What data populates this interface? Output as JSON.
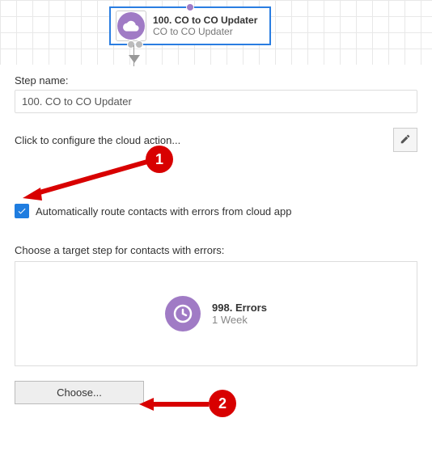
{
  "canvas": {
    "step_title": "100. CO to CO Updater",
    "step_subtitle": "CO to CO Updater",
    "icon": "cloud-icon"
  },
  "form": {
    "step_name_label": "Step name:",
    "step_name_value": "100. CO to CO Updater",
    "configure_text": "Click to configure the cloud action...",
    "edit_icon": "pencil-icon",
    "auto_route_label": "Automatically route contacts with errors from cloud app",
    "auto_route_checked": true,
    "target_label": "Choose a target step for contacts with errors:",
    "target_step_title": "998. Errors",
    "target_step_subtitle": "1 Week",
    "target_icon": "clock-icon",
    "choose_button_label": "Choose..."
  },
  "annotations": {
    "callout_1": "1",
    "callout_2": "2"
  },
  "colors": {
    "accent_purple": "#a07bc5",
    "accent_blue": "#1f7de0",
    "callout_red": "#d80000"
  }
}
